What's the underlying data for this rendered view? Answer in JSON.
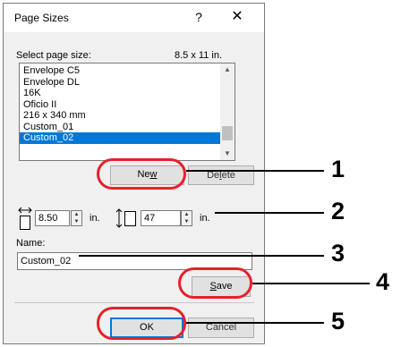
{
  "dialog": {
    "title": "Page Sizes",
    "help_glyph": "?",
    "close_glyph": "✕",
    "select_label": "Select page size:",
    "current_size": "8.5 x 11 in.",
    "page_sizes": [
      "Envelope C5",
      "Envelope DL",
      "16K",
      "Oficio II",
      "216 x 340 mm",
      "Custom_01",
      "Custom_02"
    ],
    "selected_index": 6,
    "new_button": "New",
    "delete_button": "Delete",
    "width_value": "8.50",
    "width_unit": "in.",
    "height_value": "47",
    "height_unit": "in.",
    "name_label": "Name:",
    "name_value": "Custom_02",
    "save_button": "Save",
    "ok_button": "OK",
    "cancel_button": "Cancel"
  },
  "callouts": [
    "1",
    "2",
    "3",
    "4",
    "5"
  ],
  "colors": {
    "highlight": "#e8202a",
    "selection": "#0078d7"
  }
}
